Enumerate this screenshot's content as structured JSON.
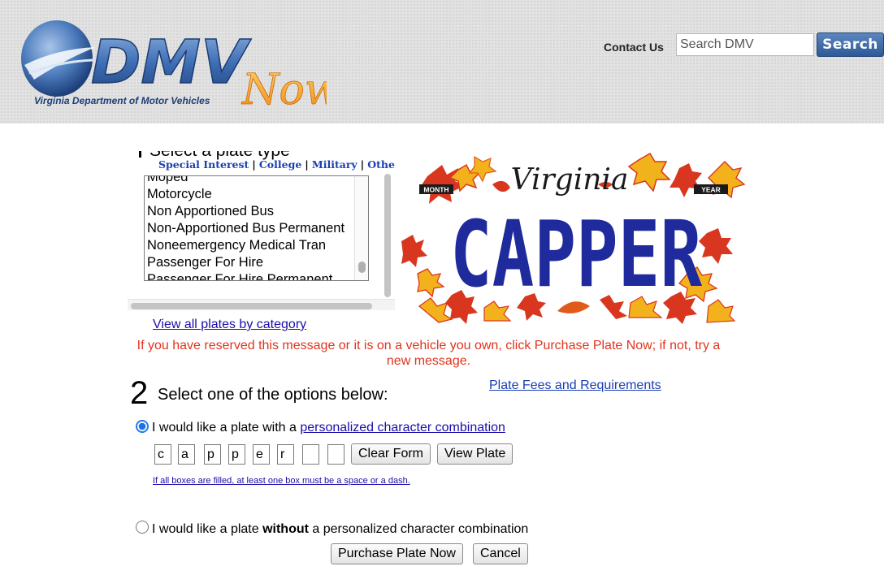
{
  "header": {
    "logo_text": "DMV",
    "logo_now": "Now",
    "logo_subtitle": "Virginia Department of Motor Vehicles",
    "contact_label": "Contact Us",
    "search_placeholder": "Search DMV",
    "search_button": "Search"
  },
  "step1": {
    "number": "1",
    "title": "Select a plate type",
    "category_links": [
      "Special Interest",
      "College",
      "Military",
      "Other"
    ],
    "list_options": [
      "Moped",
      "Motorcycle",
      "Non Apportioned Bus",
      "Non-Apportioned Bus Permanent",
      "Noneemergency Medical Tran",
      "Passenger For Hire",
      "Passenger For Hire Permanent"
    ],
    "view_all_link": "View all plates by category"
  },
  "plate_preview": {
    "state": "Virginia",
    "month_label": "MONTH",
    "year_label": "YEAR",
    "plate_text": "CAPPER",
    "colors": {
      "plate_text": "#1f2a9c",
      "leaf_red": "#d9361f",
      "leaf_yellow": "#f3b21b"
    }
  },
  "notice": "If you have reserved this message or it is on a vehicle you own, click Purchase Plate Now; if not, try a new message.",
  "step2": {
    "number": "2",
    "title": "Select one of the options below:",
    "fees_link": "Plate Fees and Requirements",
    "option_personalized_prefix": "I would like a plate with a ",
    "option_personalized_link": "personalized character combination",
    "option_personalized_selected": true,
    "characters": [
      "c",
      "a",
      "p",
      "p",
      "e",
      "r",
      "",
      ""
    ],
    "clear_button": "Clear Form",
    "view_button": "View Plate",
    "hint": "If all boxes are filled, at least one box must be a space or a dash.",
    "option_plain_prefix": "I would like a plate ",
    "option_plain_bold": "without",
    "option_plain_suffix": " a personalized character combination",
    "option_plain_selected": false
  },
  "actions": {
    "purchase_button": "Purchase Plate Now",
    "cancel_button": "Cancel"
  }
}
